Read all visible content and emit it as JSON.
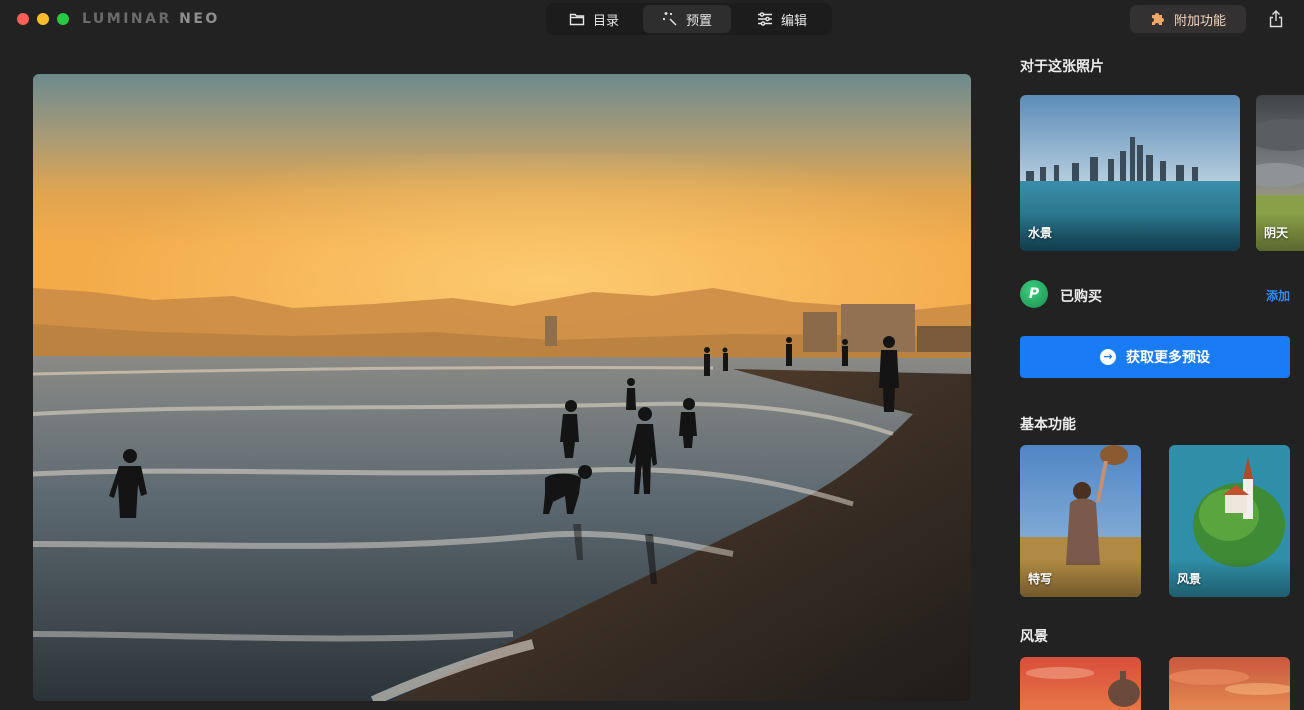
{
  "window": {
    "brand_main": "LUMINAR ",
    "brand_suffix": "NEO"
  },
  "nav": {
    "tabs": [
      {
        "label": "目录",
        "icon": "folder-icon"
      },
      {
        "label": "预置",
        "icon": "magic-wand-icon",
        "active": true
      },
      {
        "label": "编辑",
        "icon": "sliders-icon"
      }
    ],
    "addons_label": "附加功能"
  },
  "panel": {
    "about_title": "对于这张照片",
    "about_thumbs": [
      {
        "label": "水景"
      },
      {
        "label": "阴天"
      }
    ],
    "purchased": {
      "label": "已购买",
      "logo_letter": "P",
      "add_label": "添加"
    },
    "cta_label": "获取更多预设",
    "basic_title": "基本功能",
    "basic_thumbs": [
      {
        "label": "特写"
      },
      {
        "label": "风景"
      }
    ],
    "landscape_title": "风景"
  },
  "colors": {
    "accent_blue": "#1a7cf5",
    "link_blue": "#2f8cff",
    "background": "#232222"
  }
}
